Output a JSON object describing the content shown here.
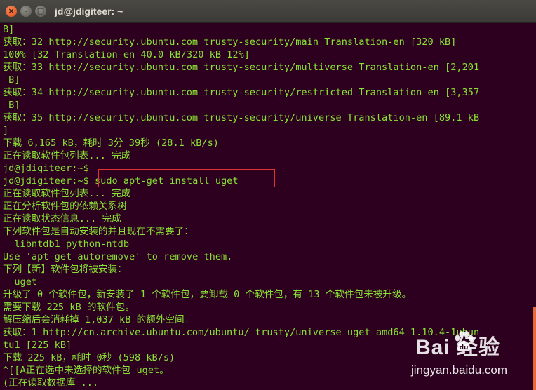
{
  "window": {
    "title": "jd@jdigiteer: ~"
  },
  "terminal": {
    "lines": [
      "B]",
      "获取：32 http://security.ubuntu.com trusty-security/main Translation-en [320 kB]",
      "100% [32 Translation-en 40.0 kB/320 kB 12%]",
      "获取：33 http://security.ubuntu.com trusty-security/multiverse Translation-en [2,201",
      " B]",
      "获取：34 http://security.ubuntu.com trusty-security/restricted Translation-en [3,357",
      " B]",
      "获取：35 http://security.ubuntu.com trusty-security/universe Translation-en [89.1 kB",
      "]",
      "下载 6,165 kB，耗时 3分 39秒 (28.1 kB/s)",
      "正在读取软件包列表... 完成",
      "jd@jdigiteer:~$",
      "jd@jdigiteer:~$ sudo apt-get install uget",
      "正在读取软件包列表... 完成",
      "正在分析软件包的依赖关系树",
      "正在读取状态信息... 完成",
      "下列软件包是自动安装的并且现在不需要了：",
      "  libntdb1 python-ntdb",
      "Use 'apt-get autoremove' to remove them.",
      "下列【新】软件包将被安装：",
      "  uget",
      "升级了 0 个软件包，新安装了 1 个软件包，要卸载 0 个软件包，有 13 个软件包未被升级。",
      "需要下载 225 kB 的软件包。",
      "解压缩后会消耗掉 1,037 kB 的额外空间。",
      "获取：1 http://cn.archive.ubuntu.com/ubuntu/ trusty/universe uget amd64 1.10.4-1ubun",
      "tu1 [225 kB]",
      "下载 225 kB，耗时 0秒 (598 kB/s)",
      "^[[A正在选中未选择的软件包 uget。",
      "(正在读取数据库 ..."
    ]
  },
  "watermark": {
    "brand": "Bai  经验",
    "url": "jingyan.baidu.com"
  },
  "colors": {
    "terminal_bg": "#2c001e",
    "terminal_text": "#8ae234",
    "highlight_border": "#e03030"
  }
}
